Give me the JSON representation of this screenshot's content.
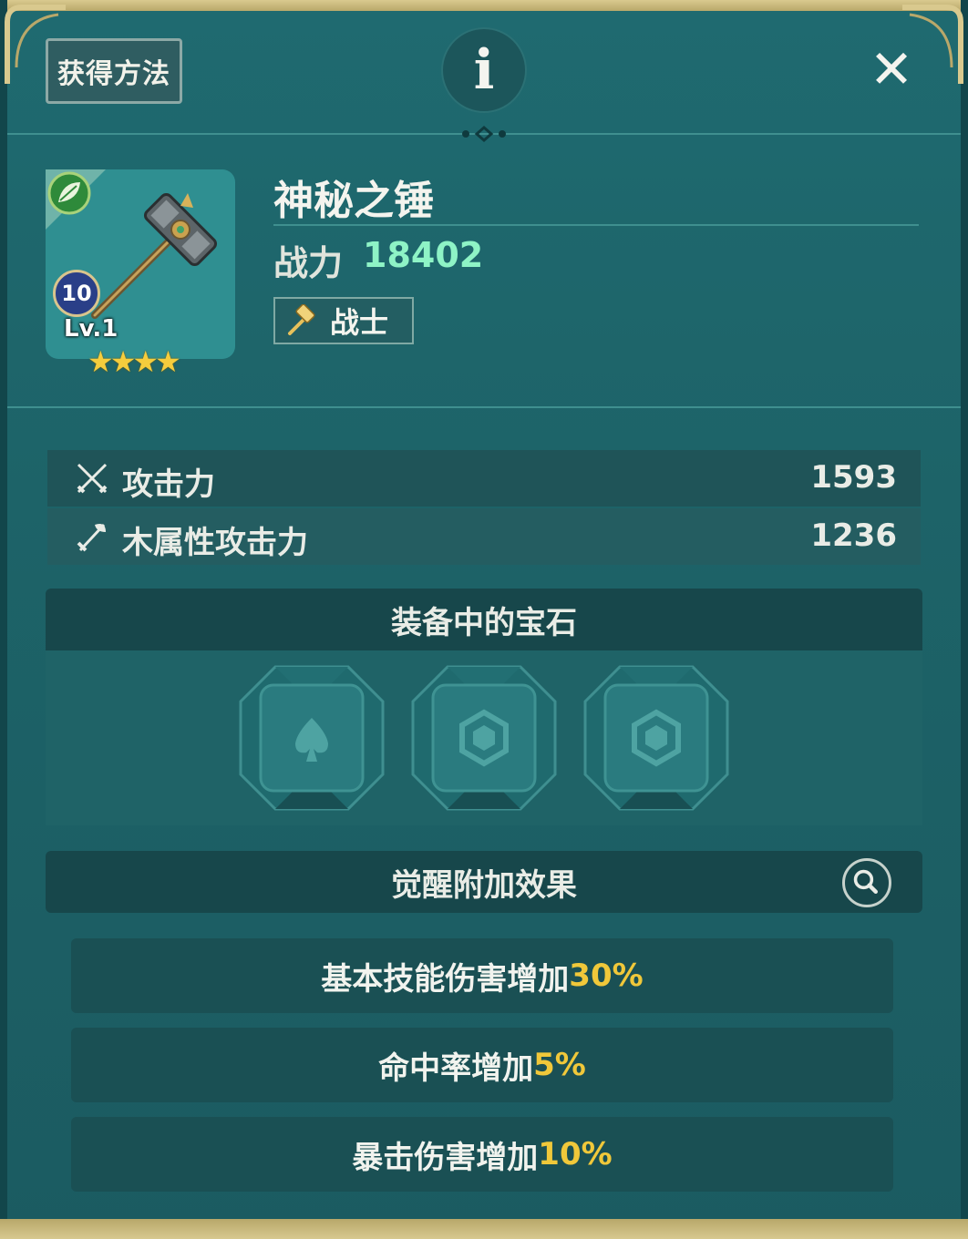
{
  "header": {
    "method_button": "获得方法",
    "info_label": "i",
    "close_label": "✕"
  },
  "item": {
    "name": "神秘之锤",
    "power_label": "战力",
    "power_value": "18402",
    "class_name": "战士",
    "badge_number": "10",
    "level_text": "Lv.1",
    "stars": "★★★★",
    "star_count": 4,
    "element_icon": "leaf-icon"
  },
  "stats": [
    {
      "icon": "crossed-swords-icon",
      "label": "攻击力",
      "value": "1593"
    },
    {
      "icon": "wood-sword-icon",
      "label": "木属性攻击力",
      "value": "1236"
    }
  ],
  "gems": {
    "title": "装备中的宝石",
    "slots": [
      {
        "icon": "spade-icon"
      },
      {
        "icon": "hexagon-gem-icon"
      },
      {
        "icon": "hexagon-gem-icon"
      }
    ]
  },
  "awakening": {
    "title": "觉醒附加效果",
    "effects": [
      {
        "text": "基本技能伤害增加",
        "num": "30%"
      },
      {
        "text": "命中率增加",
        "num": "5%"
      },
      {
        "text": "暴击伤害增加",
        "num": "10%"
      }
    ]
  },
  "colors": {
    "panel": "#1e6469",
    "gold_accent": "#d9c98e",
    "power": "#8ef3c6",
    "highlight_number": "#f0c83a"
  }
}
